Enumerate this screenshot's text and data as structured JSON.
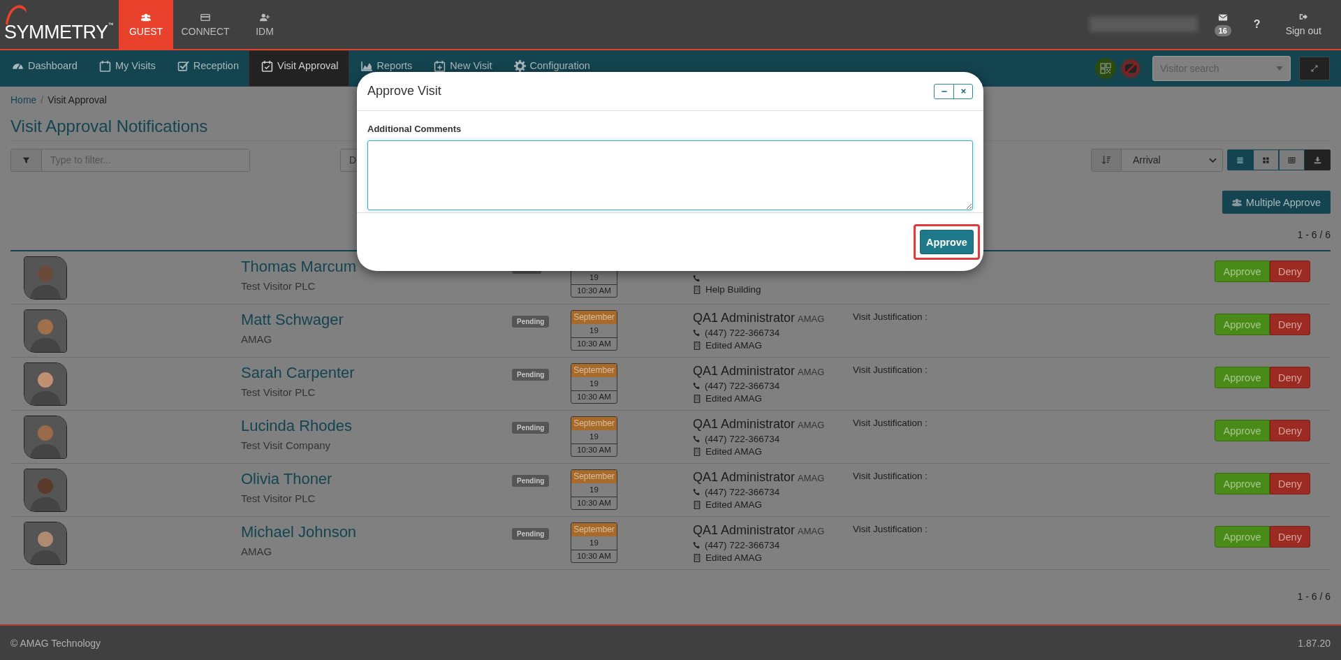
{
  "header": {
    "logo": "SYMMETRY$^{™}$",
    "modules": [
      {
        "label": "GUEST",
        "kind": "guest",
        "selected": true
      },
      {
        "label": "CONNECT",
        "kind": "card",
        "selected": false
      },
      {
        "label": "IDM",
        "kind": "user-add",
        "selected": false
      }
    ],
    "mail_count": "16",
    "help": "?",
    "sign_out": "Sign out"
  },
  "nav": {
    "items": [
      {
        "label": "Dashboard",
        "kind": "gauge",
        "selected": false
      },
      {
        "label": "My Visits",
        "kind": "calendar",
        "selected": false
      },
      {
        "label": "Reception",
        "kind": "check",
        "selected": false
      },
      {
        "label": "Visit Approval",
        "kind": "calendar-check",
        "selected": true
      },
      {
        "label": "Reports",
        "kind": "chart",
        "selected": false
      },
      {
        "label": "New Visit",
        "kind": "calendar-plus",
        "selected": false
      },
      {
        "label": "Configuration",
        "kind": "gear",
        "selected": false
      }
    ],
    "visitor_search": {
      "placeholder": "Visitor search"
    }
  },
  "breadcrumb": {
    "items": [
      "Home",
      "Visit Approval"
    ],
    "separator": "/"
  },
  "heading": "Visit Approval Notifications",
  "toolbar": {
    "filter": {
      "placeholder": "Type to filter..."
    },
    "date_button": "D",
    "sort": "Arrival",
    "views": [
      {
        "kind": "list",
        "selected": true
      },
      {
        "kind": "grid",
        "selected": false
      },
      {
        "kind": "table",
        "selected": false
      }
    ],
    "multiple_approve": "Multiple Approve"
  },
  "count_top": "1 - 6 / 6",
  "visits": [
    {
      "name": "Thomas Marcum",
      "company": "Test Visitor PLC",
      "day": "19",
      "time": "10:30 AM",
      "location": "Help Building",
      "approve": "Approve",
      "deny": "Deny"
    },
    {
      "name": "Matt Schwager",
      "company": "AMAG",
      "status": "Pending",
      "month": "September",
      "day": "19",
      "time": "10:30 AM",
      "host": "QA1 Administrator",
      "host_org": "AMAG",
      "phone": "(447) 722-366734",
      "location": "Edited AMAG",
      "justification": "Visit Justification :",
      "approve": "Approve",
      "deny": "Deny"
    },
    {
      "name": "Sarah Carpenter",
      "company": "Test Visitor PLC",
      "status": "Pending",
      "month": "September",
      "day": "19",
      "time": "10:30 AM",
      "host": "QA1 Administrator",
      "host_org": "AMAG",
      "phone": "(447) 722-366734",
      "location": "Edited AMAG",
      "justification": "Visit Justification :",
      "approve": "Approve",
      "deny": "Deny"
    },
    {
      "name": "Lucinda Rhodes",
      "company": "Test Visit Company",
      "status": "Pending",
      "month": "September",
      "day": "19",
      "time": "10:30 AM",
      "host": "QA1 Administrator",
      "host_org": "AMAG",
      "phone": "(447) 722-366734",
      "location": "Edited AMAG",
      "justification": "Visit Justification :",
      "approve": "Approve",
      "deny": "Deny"
    },
    {
      "name": "Olivia Thoner",
      "company": "Test Visitor PLC",
      "status": "Pending",
      "month": "September",
      "day": "19",
      "time": "10:30 AM",
      "host": "QA1 Administrator",
      "host_org": "AMAG",
      "phone": "(447) 722-366734",
      "location": "Edited AMAG",
      "justification": "Visit Justification :",
      "approve": "Approve",
      "deny": "Deny"
    },
    {
      "name": "Michael Johnson",
      "company": "AMAG",
      "status": "Pending",
      "month": "September",
      "day": "19",
      "time": "10:30 AM",
      "host": "QA1 Administrator",
      "host_org": "AMAG",
      "phone": "(447) 722-366734",
      "location": "Edited AMAG",
      "justification": "Visit Justification :",
      "approve": "Approve",
      "deny": "Deny"
    }
  ],
  "count_bottom": "1 - 6 / 6",
  "modal": {
    "title": "Approve Visit",
    "field_label": "Additional Comments",
    "button": "Approve",
    "highlighted": true
  },
  "footer": {
    "copyright": "© AMAG Technology",
    "version": "1.87.20"
  }
}
